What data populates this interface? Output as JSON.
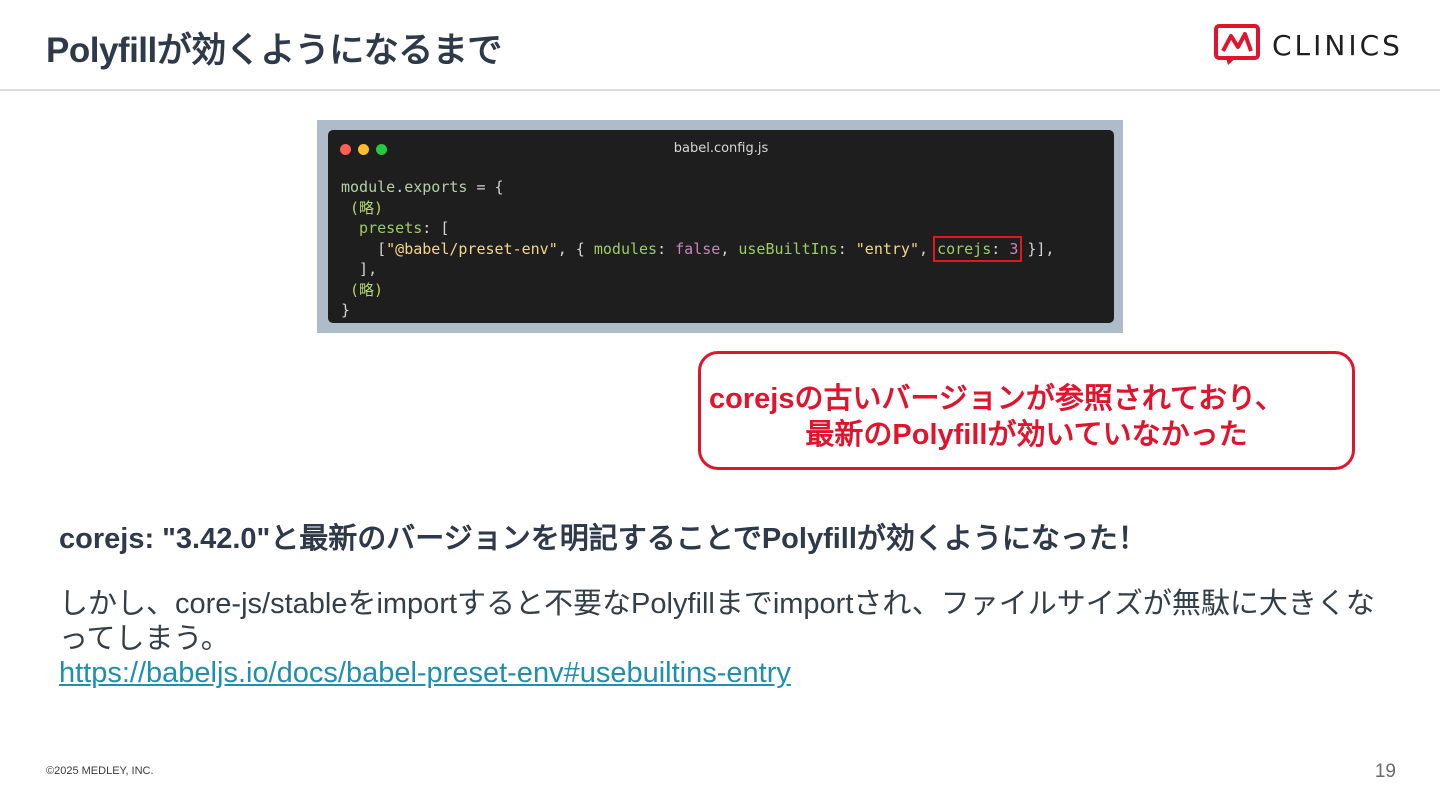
{
  "header": {
    "title": "Polyfillが効くようになるまで",
    "logo_text": "CLINICS"
  },
  "code_window": {
    "filename": "babel.config.js",
    "lines": {
      "l1a": "module",
      "l1b": ".",
      "l1c": "exports",
      "l1d": " = {",
      "l2": " (略)",
      "l3a": "  presets",
      "l3b": ": [",
      "l4a": "    [",
      "l4b": "\"@babel/preset-env\"",
      "l4c": ", { ",
      "l4d": "modules",
      "l4e": ": ",
      "l4f": "false",
      "l4g": ", ",
      "l4h": "useBuiltIns",
      "l4i": ": ",
      "l4j": "\"entry\"",
      "l4k": ", ",
      "l4l": "corejs",
      "l4m": ": ",
      "l4n": "3",
      "l4o": " }],",
      "l5": "  ],",
      "l6": " (略)",
      "l7": "}"
    }
  },
  "callout": {
    "line1": "corejsの古いバージョンが参照されており、",
    "line2": "最新のPolyfillが効いていなかった"
  },
  "main": {
    "headline": "corejs: \"3.42.0\"と最新のバージョンを明記することでPolyfillが効くようになった！",
    "body": "しかし、core-js/stableをimportすると不要なPolyfillまでimportされ、ファイルサイズが無駄に大きくなってしまう。",
    "link": "https://babeljs.io/docs/babel-preset-env#usebuiltins-entry"
  },
  "footer": {
    "copyright": "©2025 MEDLEY, INC.",
    "page_number": "19"
  },
  "colors": {
    "accent_red": "#e0152d",
    "link_teal": "#1f8fb0",
    "title_navy": "#2e3a4a"
  }
}
